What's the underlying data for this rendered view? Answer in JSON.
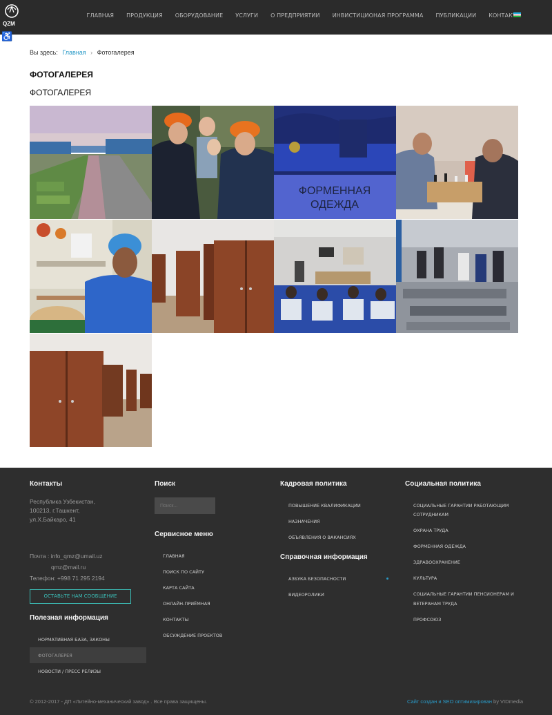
{
  "header": {
    "logo_text": "QZM",
    "nav": [
      "ГЛАВНАЯ",
      "ПРОДУКЦИЯ",
      "ОБОРУДОВАНИЕ",
      "УСЛУГИ",
      "О ПРЕДПРИЯТИИ",
      "ИНВИСТИЦИОНАЯ ПРОГРАММА",
      "ПУБЛИКАЦИИ",
      "КОНТАКТЫ"
    ],
    "language_flag": "uzbekistan-flag-icon"
  },
  "breadcrumb": {
    "prefix": "Вы здесь:",
    "home": "Главная",
    "separator": "›",
    "current": "Фотогалерея"
  },
  "page": {
    "title": "ФОТОГАЛЕРЕЯ",
    "subtitle": "ФОТОГАЛЕРЕЯ"
  },
  "gallery": {
    "uniform_overlay_text": [
      "ФОРМЕННАЯ",
      "ОДЕЖДА"
    ],
    "items": [
      "factory-aerial-photo",
      "workers-hardhats-photo",
      "uniform-photo",
      "chess-players-photo",
      "canteen-worker-photo",
      "locker-room-photo",
      "meeting-hall-photo",
      "workshop-photo",
      "lockers-photo"
    ]
  },
  "footer": {
    "contacts": {
      "heading": "Контакты",
      "address": [
        "Республика Узбекистан,",
        "100213, г.Ташкент,",
        "ул.Х.Байкаро, 41"
      ],
      "mail_label": "Почта : info_qmz@umail.uz",
      "mail_alt": "qmz@mail.ru",
      "phone": "Телефон: +998 71 295 2194",
      "button": "ОСТАВЬТЕ НАМ СООБЩЕНИЕ"
    },
    "useful": {
      "heading": "Полезная информация",
      "items": [
        "НОРМАТИВНАЯ БАЗА, ЗАКОНЫ",
        "ФОТОГАЛЕРЕЯ",
        "НОВОСТИ / ПРЕСС РЕЛИЗЫ"
      ]
    },
    "search": {
      "heading": "Поиск",
      "placeholder": "Поиск..."
    },
    "service": {
      "heading": "Сервисное меню",
      "items": [
        "ГЛАВНАЯ",
        "ПОИСК ПО САЙТУ",
        "КАРТА САЙТА",
        "ОНЛАЙН-ПРИЁМНАЯ",
        "КОНТАКТЫ",
        "ОБСУЖДЕНИЕ ПРОЕКТОВ"
      ]
    },
    "hr": {
      "heading": "Кадровая политика",
      "items": [
        "ПОВЫШЕНИЕ КВАЛИФИКАЦИИ",
        "НАЗНАЧЕНИЯ",
        "ОБЪЯВЛЕНИЯ О ВАКАНСИЯХ"
      ]
    },
    "reference": {
      "heading": "Справочная информация",
      "items": [
        "АЗБУКА БЕЗОПАСНОСТИ",
        "ВИДЕОРОЛИКИ"
      ]
    },
    "social": {
      "heading": "Социальная политика",
      "items": [
        "СОЦИАЛЬНЫЕ ГАРАНТИИ РАБОТАЮЩИМ",
        "СОТРУДНИКАМ",
        "ОХРАНА ТРУДА",
        "ФОРМЕННАЯ ОДЕЖДА",
        "ЗДРАВООХРАНЕНИЕ",
        "КУЛЬТУРА",
        "СОЦИАЛЬНЫЕ ГАРАНТИИ ПЕНСИОНЕРАМ И",
        "ВЕТЕРАНАМ ТРУДА",
        "ПРОФСОЮЗ"
      ]
    },
    "copyright": "© 2012-2017 - ДП «Литейно-механический завод» . Все права защищены.",
    "credit_link": "Сайт создан и SEO оптимизирован",
    "credit_suffix": " by VIDmedia"
  },
  "colors": {
    "header_bg": "#2b2b2b",
    "footer_bg": "#2e2e2e",
    "accent": "#2a9ac7",
    "button_border": "#3bbdb6"
  }
}
